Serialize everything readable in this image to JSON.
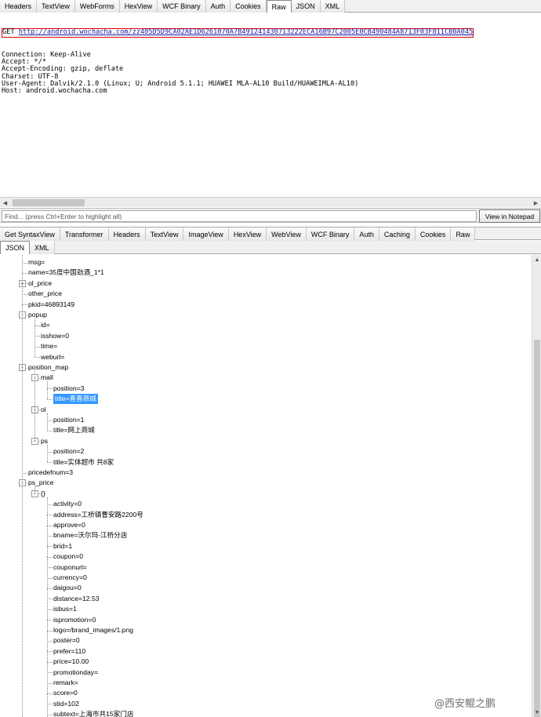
{
  "top_tabs": [
    "Headers",
    "TextView",
    "WebForms",
    "HexView",
    "WCF Binary",
    "Auth",
    "Cookies",
    "Raw",
    "JSON",
    "XML"
  ],
  "top_active_tab": "Raw",
  "request": {
    "method": "GET",
    "url": "http://android.wochacha.com/zz405D5D9CA02AE1D6261070A7B491241430713222ECA16B97C2005E0CB490484A8713F03F811CB0A045",
    "headers": [
      "Connection: Keep-Alive",
      "Accept: */*",
      "Accept-Encoding: gzip, deflate",
      "Charset: UTF-8",
      "User-Agent: Dalvik/2.1.0 (Linux; U; Android 5.1.1; HUAWEI MLA-AL10 Build/HUAWEIMLA-AL10)",
      "Host: android.wochacha.com"
    ]
  },
  "find": {
    "placeholder": "Find... (press Ctrl+Enter to highlight all)",
    "notepad_label": "View in Notepad"
  },
  "response_tabs": [
    "Get SyntaxView",
    "Transformer",
    "Headers",
    "TextView",
    "ImageView",
    "HexView",
    "WebView",
    "WCF Binary",
    "Auth",
    "Caching",
    "Cookies",
    "Raw"
  ],
  "format_tabs": [
    "JSON",
    "XML"
  ],
  "format_active_tab": "JSON",
  "tree": [
    {
      "text": "msg=",
      "level": 1
    },
    {
      "text": "name=35度中国劲酒_1*1",
      "level": 1
    },
    {
      "text": "ol_price",
      "level": 1,
      "expander": "+"
    },
    {
      "text": "other_price",
      "level": 1
    },
    {
      "text": "pkid=46893149",
      "level": 1
    },
    {
      "text": "popup",
      "level": 1,
      "expander": "-"
    },
    {
      "text": "id=",
      "level": 2
    },
    {
      "text": "isshow=0",
      "level": 2
    },
    {
      "text": "time=",
      "level": 2
    },
    {
      "text": "weburl=",
      "level": 2
    },
    {
      "text": "position_map",
      "level": 1,
      "expander": "-"
    },
    {
      "text": "mall",
      "level": 2,
      "expander": "-"
    },
    {
      "text": "position=3",
      "level": 3
    },
    {
      "text": "title=喜喜商城",
      "level": 3,
      "selected": true
    },
    {
      "text": "ol",
      "level": 2,
      "expander": "-"
    },
    {
      "text": "position=1",
      "level": 3
    },
    {
      "text": "title=网上商城",
      "level": 3
    },
    {
      "text": "ps",
      "level": 2,
      "expander": "-"
    },
    {
      "text": "position=2",
      "level": 3
    },
    {
      "text": "title=实体超市 共8家",
      "level": 3
    },
    {
      "text": "pricedefnum=3",
      "level": 1
    },
    {
      "text": "ps_price",
      "level": 1,
      "expander": "-"
    },
    {
      "text": "{}",
      "level": 2,
      "expander": "-"
    },
    {
      "text": "activity=0",
      "level": 3
    },
    {
      "text": "address=工桥镇曹安路2200号",
      "level": 3
    },
    {
      "text": "approve=0",
      "level": 3
    },
    {
      "text": "bname=沃尔玛-江桥分店",
      "level": 3
    },
    {
      "text": "brid=1",
      "level": 3
    },
    {
      "text": "coupon=0",
      "level": 3
    },
    {
      "text": "couponurl=",
      "level": 3
    },
    {
      "text": "currency=0",
      "level": 3
    },
    {
      "text": "daigou=0",
      "level": 3
    },
    {
      "text": "distance=12.53",
      "level": 3
    },
    {
      "text": "isbus=1",
      "level": 3
    },
    {
      "text": "ispromotion=0",
      "level": 3
    },
    {
      "text": "logo=/brand_images/1.png",
      "level": 3
    },
    {
      "text": "poster=0",
      "level": 3
    },
    {
      "text": "prefer=110",
      "level": 3
    },
    {
      "text": "price=10.00",
      "level": 3
    },
    {
      "text": "promotionday=",
      "level": 3
    },
    {
      "text": "remark=",
      "level": 3
    },
    {
      "text": "score=0",
      "level": 3
    },
    {
      "text": "stid=102",
      "level": 3
    },
    {
      "text": "subtext=上海市共15家门店",
      "level": 3
    }
  ],
  "watermark": "@西安鲲之鹏",
  "icons": {
    "scroll-left": "◀",
    "scroll-right": "▶",
    "scroll-up": "▲",
    "scroll-down": "▼",
    "expanded": "-",
    "collapsed": "+"
  }
}
